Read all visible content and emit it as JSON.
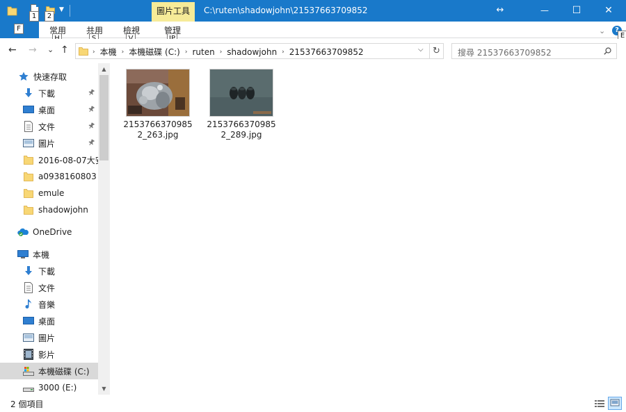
{
  "window": {
    "title_path": "C:\\ruten\\shadowjohn\\21537663709852",
    "context_tab": "圖片工具",
    "resize_glyph": "↔",
    "minimize": "—",
    "maximize": "☐",
    "close": "✕"
  },
  "quick_access_toolbar": {
    "keytip_1": "1",
    "keytip_2": "2"
  },
  "ribbon": {
    "file_tab": "檔",
    "file_keytip": "F",
    "tabs": [
      {
        "label": "常用",
        "keytip": "H"
      },
      {
        "label": "共用",
        "keytip": "S"
      },
      {
        "label": "檢視",
        "keytip": "V"
      },
      {
        "label": "管理",
        "keytip": "JP"
      }
    ],
    "help_keytip": "E",
    "help_glyph": "?"
  },
  "address": {
    "crumbs": [
      "本機",
      "本機磁碟 (C:)",
      "ruten",
      "shadowjohn",
      "21537663709852"
    ],
    "separator": "›",
    "dropdown_glyph": "⌵",
    "refresh_glyph": "↻"
  },
  "search": {
    "placeholder": "搜尋 21537663709852"
  },
  "nav": {
    "back": "←",
    "forward": "→",
    "recent": "⌄",
    "up": "↑"
  },
  "sidebar": {
    "quick_access_label": "快速存取",
    "quick_items": [
      {
        "label": "下載",
        "icon": "download-icon",
        "pinned": true
      },
      {
        "label": "桌面",
        "icon": "desktop-icon",
        "pinned": true
      },
      {
        "label": "文件",
        "icon": "document-icon",
        "pinned": true
      },
      {
        "label": "圖片",
        "icon": "pictures-icon",
        "pinned": true
      },
      {
        "label": "2016-08-07大安",
        "icon": "folder-icon",
        "pinned": false
      },
      {
        "label": "a0938160803",
        "icon": "folder-icon",
        "pinned": false
      },
      {
        "label": "emule",
        "icon": "folder-icon",
        "pinned": false
      },
      {
        "label": "shadowjohn",
        "icon": "folder-icon",
        "pinned": false
      }
    ],
    "onedrive_label": "OneDrive",
    "this_pc_label": "本機",
    "pc_items": [
      {
        "label": "下載",
        "icon": "download-icon"
      },
      {
        "label": "文件",
        "icon": "document-icon"
      },
      {
        "label": "音樂",
        "icon": "music-icon"
      },
      {
        "label": "桌面",
        "icon": "desktop-icon"
      },
      {
        "label": "圖片",
        "icon": "pictures-icon"
      },
      {
        "label": "影片",
        "icon": "video-icon"
      },
      {
        "label": "本機磁碟 (C:)",
        "icon": "drive-c-icon",
        "selected": true
      },
      {
        "label": "3000 (E:)",
        "icon": "drive-icon"
      }
    ]
  },
  "files": [
    {
      "name": "21537663709852_263.jpg",
      "thumb": "carburetor-photo"
    },
    {
      "name": "21537663709852_289.jpg",
      "thumb": "rubber-parts-photo"
    }
  ],
  "status": {
    "item_count": "2 個項目"
  },
  "colors": {
    "titlebar": "#1979ca",
    "context_tab": "#f6eb98",
    "selection": "#cce8ff",
    "folder": "#f8d775"
  }
}
